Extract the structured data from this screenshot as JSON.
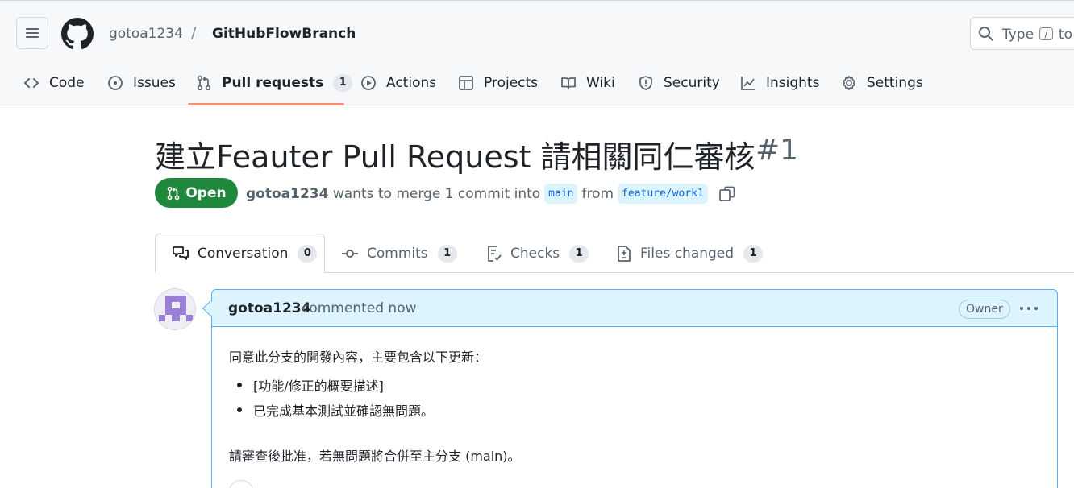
{
  "header": {
    "owner": "gotoa1234",
    "separator": "/",
    "repo": "GitHubFlowBranch",
    "search_prefix": "Type",
    "search_key": "/",
    "search_suffix": "to"
  },
  "nav": {
    "tabs": [
      {
        "label": "Code",
        "icon": "code-icon"
      },
      {
        "label": "Issues",
        "icon": "issue-opened-icon"
      },
      {
        "label": "Pull requests",
        "icon": "git-pull-request-icon",
        "count": "1",
        "active": true
      },
      {
        "label": "Actions",
        "icon": "play-icon"
      },
      {
        "label": "Projects",
        "icon": "table-icon"
      },
      {
        "label": "Wiki",
        "icon": "book-icon"
      },
      {
        "label": "Security",
        "icon": "shield-icon"
      },
      {
        "label": "Insights",
        "icon": "graph-icon"
      },
      {
        "label": "Settings",
        "icon": "gear-icon"
      }
    ],
    "active_underline_color": "#fd8c73"
  },
  "pr": {
    "title": "建立Feauter Pull Request 請相關同仁審核",
    "number": "#1",
    "state": "Open",
    "state_color": "#1f883d",
    "author": "gotoa1234",
    "merge_text": "wants to merge 1 commit into",
    "base_branch": "main",
    "from_text": "from",
    "head_branch": "feature/work1"
  },
  "pr_tabs": [
    {
      "label": "Conversation",
      "count": "0",
      "icon": "comment-discussion-icon"
    },
    {
      "label": "Commits",
      "count": "1",
      "icon": "git-commit-icon"
    },
    {
      "label": "Checks",
      "count": "1",
      "icon": "checklist-icon"
    },
    {
      "label": "Files changed",
      "count": "1",
      "icon": "file-diff-icon"
    }
  ],
  "comment": {
    "author": "gotoa1234",
    "meta": "commented now",
    "role_badge": "Owner",
    "intro": "同意此分支的開發內容，主要包含以下更新：",
    "bullets": [
      "[功能/修正的概要描述]",
      "已完成基本測試並確認無問題。"
    ],
    "closing": "請審查後批准，若無問題將合併至主分支 (main)。"
  }
}
